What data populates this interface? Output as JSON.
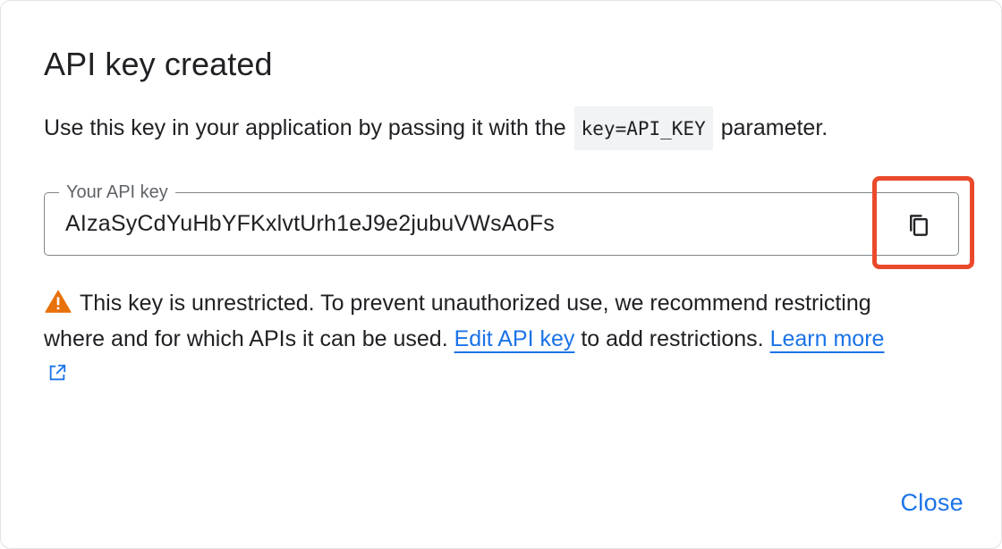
{
  "dialog": {
    "title": "API key created",
    "description": {
      "before": "Use this key in your application by passing it with the",
      "code": "key=API_KEY",
      "after": "parameter."
    },
    "field": {
      "label": "Your API key",
      "value": "AIzaSyCdYuHbYFKxlvtUrh1eJ9e2jubuVWsAoFs",
      "copy_icon": "copy-icon"
    },
    "warning": {
      "icon": "warning-icon",
      "text_part1": "This key is unrestricted. To prevent unauthorized use, we recommend restricting where and for which APIs it can be used.",
      "edit_link": "Edit API key",
      "text_part2": "to add restrictions.",
      "learn_more_link": "Learn more",
      "external_icon": "external-link-icon"
    },
    "close_label": "Close"
  },
  "colors": {
    "link": "#1a73e8",
    "highlight": "#ea4a2b",
    "warning": "#e8710a",
    "code_bg": "#f1f3f4"
  }
}
